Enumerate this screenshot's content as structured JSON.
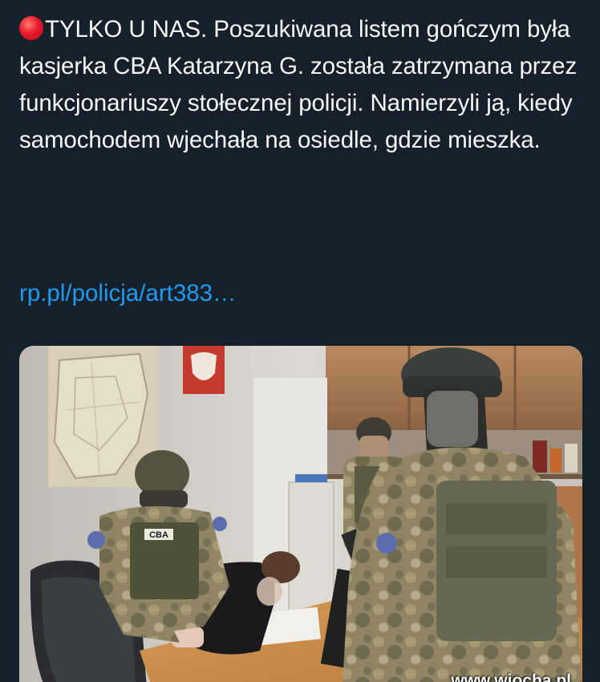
{
  "tweet": {
    "headline": "TYLKO U NAS.",
    "body": "Poszukiwana listem gończym była kasjerka CBA Katarzyna G. została zatrzymana przez funkcjonariuszy stołecznej policji. Namierzyli ją, kiedy samochodem wjechała na osiedle, gdzie mieszka.",
    "link": "rp.pl/policja/art383…"
  },
  "media": {
    "vest_label": "CBA",
    "watermark": "www.wiocha.pl"
  },
  "colors": {
    "background": "#15202b",
    "text": "#f7f9f9",
    "link": "#1d9bf0",
    "status_dot": "#e8192c"
  },
  "icons": [
    "red-circle-icon"
  ]
}
